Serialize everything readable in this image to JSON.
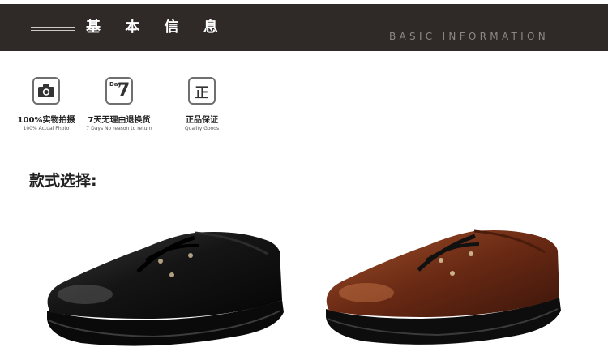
{
  "banner": {
    "title": "基 本 信 息",
    "subtitle": "BASIC INFORMATION"
  },
  "features": [
    {
      "icon": "camera-icon",
      "title": "100%实物拍摄",
      "subtitle": "100% Actual Photo"
    },
    {
      "icon": "day7-icon",
      "icon_text": "Day",
      "icon_number": "7",
      "title": "7天无理由退换货",
      "subtitle": "7 Days No reason to return"
    },
    {
      "icon": "quality-icon",
      "icon_text": "正",
      "title": "正品保证",
      "subtitle": "Quality Goods"
    }
  ],
  "style_label": "款式选择:",
  "products": [
    {
      "name": "black-shoe",
      "color": "#151515"
    },
    {
      "name": "brown-shoe",
      "color": "#6a2a14"
    }
  ],
  "colors": {
    "banner_bg": "#2f2a28",
    "banner_text": "#ffffff",
    "banner_subtitle": "#8d8884"
  }
}
